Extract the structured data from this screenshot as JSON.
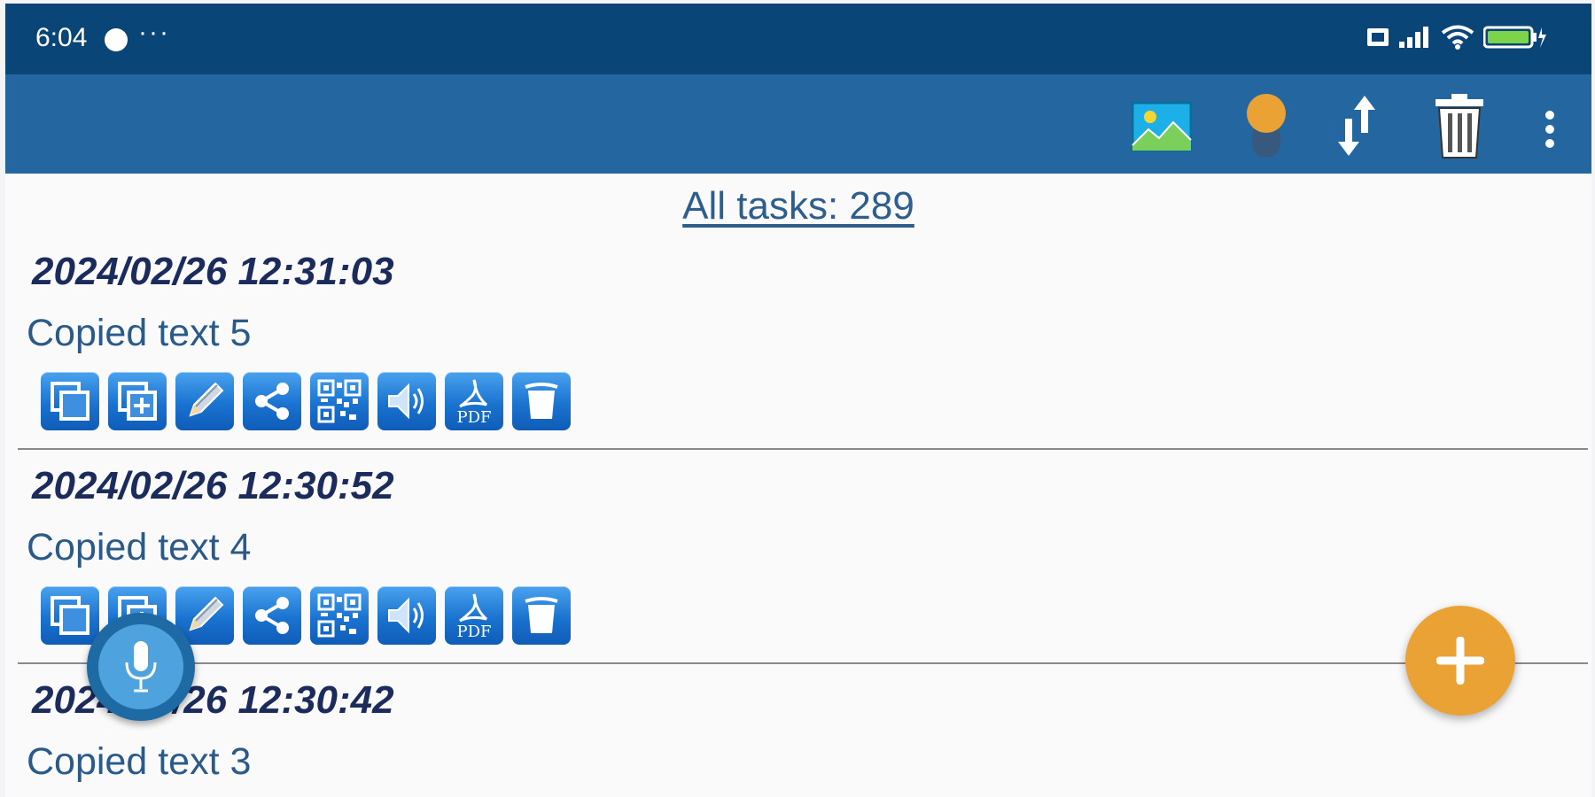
{
  "status_bar": {
    "time": "6:04",
    "more": "···",
    "icons": [
      "sim-icon",
      "signal-icon",
      "wifi-icon",
      "battery-charging-icon"
    ]
  },
  "toolbar": {
    "icons": [
      "image-icon",
      "theme-toggle-icon",
      "sort-icon",
      "trash-icon",
      "overflow-menu-icon"
    ]
  },
  "list": {
    "header": "All tasks: 289",
    "entries": [
      {
        "date": "2024/02/26 12:31:03",
        "text": "Copied text 5"
      },
      {
        "date": "2024/02/26 12:30:52",
        "text": "Copied text 4"
      },
      {
        "date": "2024/02/26 12:30:42",
        "text": "Copied text 3"
      }
    ],
    "action_icons": [
      "copy-icon",
      "copy-add-icon",
      "edit-icon",
      "share-icon",
      "qr-code-icon",
      "speaker-icon",
      "pdf-icon",
      "delete-icon"
    ],
    "pdf_label": "PDF"
  },
  "colors": {
    "status_bar": "#0a4577",
    "toolbar": "#2467a0",
    "accent": "#eba234",
    "action_button": "#1a73d0"
  }
}
